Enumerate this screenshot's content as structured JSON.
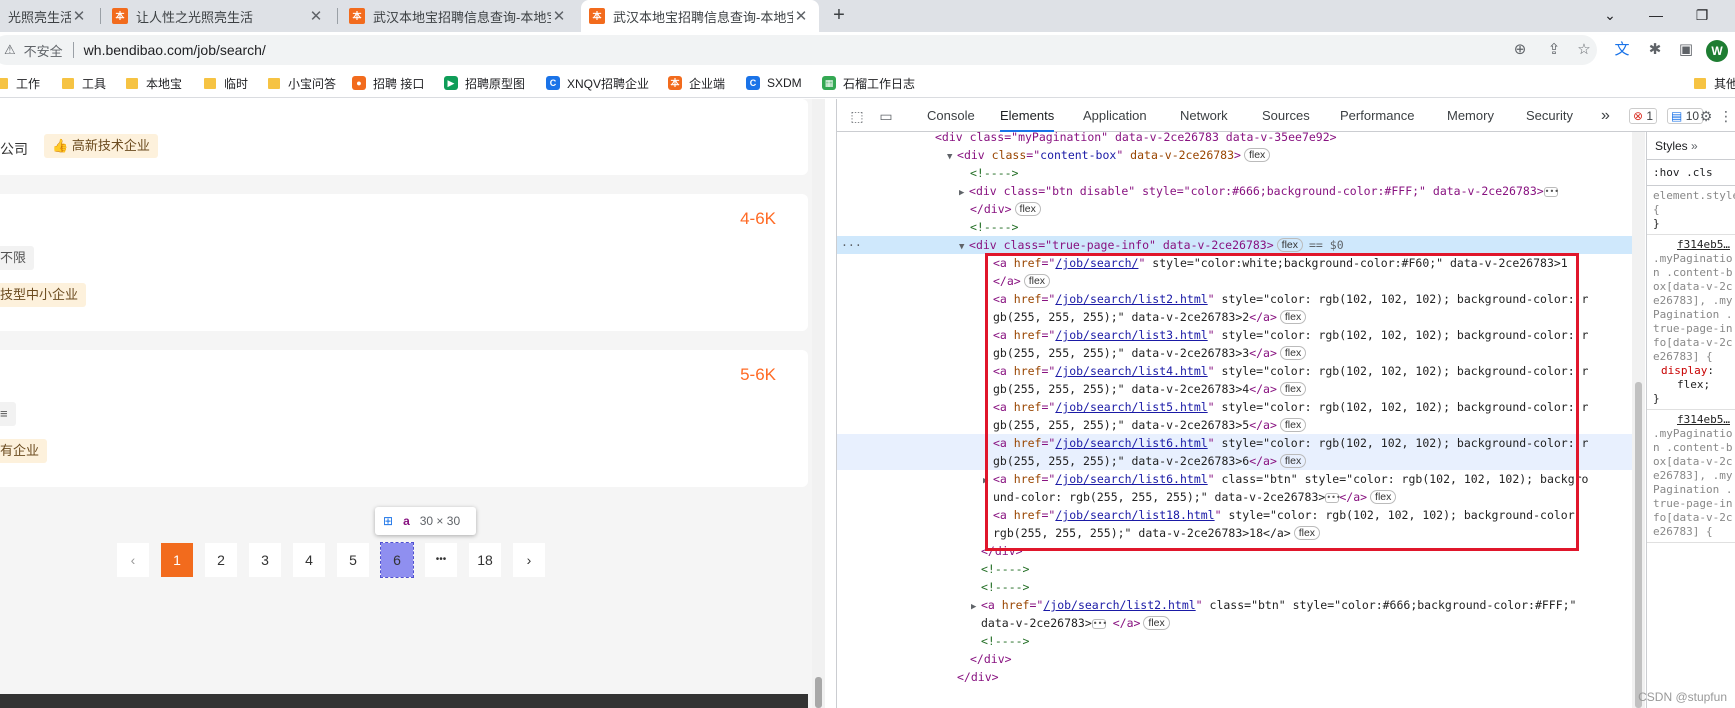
{
  "browser": {
    "tabs": [
      {
        "title": "光照亮生活",
        "close": "✕"
      },
      {
        "title": "让人性之光照亮生活",
        "close": "✕"
      },
      {
        "title": "武汉本地宝招聘信息查询-本地宝",
        "close": "✕",
        "favicon": "本"
      },
      {
        "title": "武汉本地宝招聘信息查询-本地宝",
        "close": "✕",
        "favicon": "本"
      }
    ],
    "new_tab": "+",
    "window_controls": {
      "chevron": "⌄",
      "minimize": "—",
      "restore": "❐"
    },
    "security_label": "不安全",
    "url": "wh.bendibao.com/job/search/",
    "avatar_letter": "W",
    "bookmarks": [
      {
        "label": "工作",
        "type": "folder"
      },
      {
        "label": "工具",
        "type": "folder"
      },
      {
        "label": "本地宝",
        "type": "folder"
      },
      {
        "label": "临时",
        "type": "folder"
      },
      {
        "label": "小宝问答",
        "type": "folder"
      },
      {
        "label": "招聘 接口",
        "type": "site",
        "color": "#f26b1d"
      },
      {
        "label": "招聘原型图",
        "type": "site",
        "color": "#0f9d58"
      },
      {
        "label": "XNQV招聘企业",
        "type": "site",
        "color": "#1a73e8"
      },
      {
        "label": "企业端",
        "type": "site",
        "color": "#f26b1d"
      },
      {
        "label": "SXDM",
        "type": "site",
        "color": "#1a73e8"
      },
      {
        "label": "石榴工作日志",
        "type": "site",
        "color": "#34a853"
      },
      {
        "label": "其他",
        "type": "folder"
      }
    ]
  },
  "page": {
    "cards": [
      {
        "company": "公司",
        "tags": [
          "高新技术企业"
        ]
      },
      {
        "salary": "4-6K",
        "tag_gray": "不限",
        "tag_yellow": "技型中小企业"
      },
      {
        "salary": "5-6K",
        "tag_gray": "≡",
        "tag_yellow": "有企业"
      }
    ],
    "pagination": {
      "prev": "‹",
      "pages": [
        "1",
        "2",
        "3",
        "4",
        "5",
        "6"
      ],
      "ellipsis": "•••",
      "last": "18",
      "next": "›"
    },
    "tooltip": {
      "tag": "a",
      "size": "30 × 30"
    }
  },
  "devtools": {
    "tabs": [
      "Console",
      "Elements",
      "Application",
      "Network",
      "Sources",
      "Performance",
      "Memory",
      "Security"
    ],
    "more": "»",
    "errors": "1",
    "messages": "10",
    "flex": "flex",
    "eq0": "== $0",
    "styles": {
      "title": "Styles",
      "filter": ":hov .cls",
      "element_style": "element.style {",
      "close_brace": "}",
      "source1": "f314eb5…",
      "selector1": ".myPagination .content-box[data-v-2ce26783], .myPagination .true-page-info[data-v-2ce26783] {",
      "prop": "display",
      "value": "flex;",
      "source2": "f314eb5…",
      "selector2": ".myPagination .content-box[data-v-2ce26783], .myPagination .true-page-info[data-v-2ce26783] {"
    },
    "code": {
      "l0": "<div class=\"myPagination\" data-v-2ce26783 data-v-35ee7e92>",
      "l1_open": "div",
      "l1_class": "content-box",
      "l1_data": "data-v-2ce26783",
      "comment": "<!---->",
      "btn_disable": "div class=\"btn disable\" style=\"color:#666;background-color:#FFF;\" data-v-2ce26783>",
      "div_close": "</div>",
      "true_page": "div class=\"true-page-info\" data-v-2ce26783>",
      "a1_href": "/job/search/",
      "a1_rest": " style=\"color:white;background-color:#F60;\" data-v-2ce26783>1",
      "a_close": "</a>",
      "rgb_style": " style=\"color: rgb(102, 102, 102); background-color: r",
      "rgb_tail": "gb(255, 255, 255);\" data-v-2ce26783>",
      "a2_href": "/job/search/list2.html",
      "a2_num": "2",
      "a3_href": "/job/search/list3.html",
      "a3_num": "3",
      "a4_href": "/job/search/list4.html",
      "a4_num": "4",
      "a5_href": "/job/search/list5.html",
      "a5_num": "5",
      "a6_href": "/job/search/list6.html",
      "a6_num": "6",
      "a7_href": "/job/search/list6.html",
      "a7_rest": " class=\"btn\" style=\"color: rgb(102, 102, 102); backgro",
      "a7_tail": "und-color: rgb(255, 255, 255);\" data-v-2ce26783>",
      "a18_href": "/job/search/list18.html",
      "a18_rest": " style=\"color: rgb(102, 102, 102); background-color:",
      "a18_tail": "rgb(255, 255, 255);\" data-v-2ce26783>18</a>",
      "next_href": "/job/search/list2.html",
      "next_rest": " class=\"btn\" style=\"color:#666;background-color:#FFF;\"",
      "next_tail": "data-v-2ce26783>",
      "div_end": "</div>"
    }
  },
  "watermark": "CSDN @stupfun"
}
